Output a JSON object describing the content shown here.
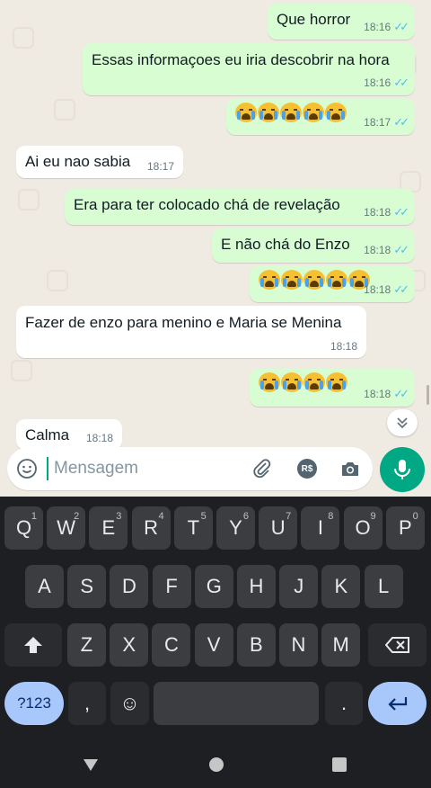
{
  "messages": [
    {
      "dir": "out",
      "text": "Que horror",
      "time": "18:16",
      "ticks": true
    },
    {
      "dir": "out",
      "text": "Essas informaçoes eu iria descobrir na hora",
      "time": "18:16",
      "ticks": true
    },
    {
      "dir": "out",
      "emoji": "loudly-crying-face",
      "count": 5,
      "time": "18:17",
      "ticks": true
    },
    {
      "dir": "in",
      "text": "Ai eu nao sabia",
      "time": "18:17"
    },
    {
      "dir": "out",
      "text": "Era para ter colocado chá de revelação",
      "time": "18:18",
      "ticks": true
    },
    {
      "dir": "out",
      "text": "E não chá do Enzo",
      "time": "18:18",
      "ticks": true
    },
    {
      "dir": "out",
      "emoji": "loudly-crying-face",
      "count": 5,
      "time": "18:18",
      "ticks": true
    },
    {
      "dir": "in",
      "text": "Fazer de enzo para menino e Maria se Menina",
      "time": "18:18"
    },
    {
      "dir": "out",
      "emoji": "loudly-crying-face",
      "count": 4,
      "time": "18:18",
      "ticks": true
    },
    {
      "dir": "in",
      "text": "Calma",
      "time": "18:18"
    }
  ],
  "composer": {
    "placeholder": "Mensagem",
    "icons": [
      "emoji-icon",
      "attach-icon",
      "payment-icon",
      "camera-icon"
    ],
    "payment_label": "R$"
  },
  "keyboard": {
    "row1": [
      [
        "Q",
        "1"
      ],
      [
        "W",
        "2"
      ],
      [
        "E",
        "3"
      ],
      [
        "R",
        "4"
      ],
      [
        "T",
        "5"
      ],
      [
        "Y",
        "6"
      ],
      [
        "U",
        "7"
      ],
      [
        "I",
        "8"
      ],
      [
        "O",
        "9"
      ],
      [
        "P",
        "0"
      ]
    ],
    "row2": [
      "A",
      "S",
      "D",
      "F",
      "G",
      "H",
      "J",
      "K",
      "L"
    ],
    "row3": [
      "Z",
      "X",
      "C",
      "V",
      "B",
      "N",
      "M"
    ],
    "symbols_label": "?123",
    "comma": ",",
    "period": ".",
    "emoji_key": "☺"
  },
  "colors": {
    "accent": "#00a884",
    "outgoing_bubble": "#d9fdd3",
    "incoming_bubble": "#ffffff",
    "read_ticks": "#53bdeb"
  }
}
